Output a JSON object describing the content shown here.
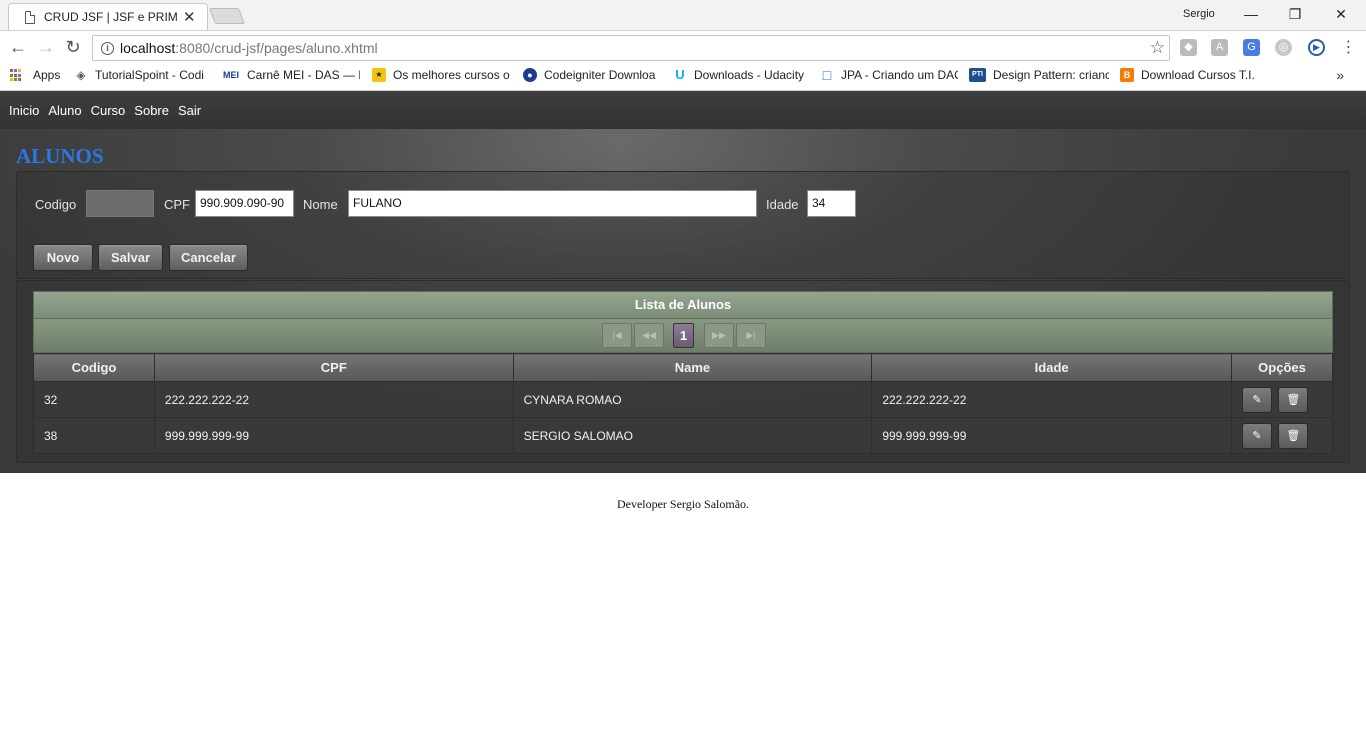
{
  "browser": {
    "tab_title": "CRUD JSF | JSF e PRIMEFACES",
    "tab_close": "✕",
    "profile": "Sergio",
    "window": {
      "minimize": "—",
      "restore": "❐",
      "close": "✕"
    },
    "nav": {
      "back": "←",
      "forward": "→",
      "reload": "↻"
    },
    "url_host": "localhost",
    "url_rest": ":8080/crud-jsf/pages/aluno.xhtml",
    "bookmarks": {
      "apps": "Apps",
      "items": [
        {
          "label": "TutorialSpoint - Codi",
          "icon": "◈"
        },
        {
          "label": "Carnê MEI - DAS — P",
          "icon": "MEI"
        },
        {
          "label": "Os melhores cursos o",
          "icon": "★"
        },
        {
          "label": "Codeigniter Downloa",
          "icon": "●"
        },
        {
          "label": "Downloads - Udacity",
          "icon": "U"
        },
        {
          "label": "JPA - Criando um DAO",
          "icon": "□"
        },
        {
          "label": "Design Pattern: crianc",
          "icon": "PTI"
        },
        {
          "label": "Download Cursos T.I.",
          "icon": "B"
        }
      ],
      "more": "»"
    }
  },
  "menu": [
    "Inicio",
    "Aluno",
    "Curso",
    "Sobre",
    "Sair"
  ],
  "page_title": "ALUNOS",
  "form": {
    "codigo_label": "Codigo",
    "codigo_value": "",
    "cpf_label": "CPF",
    "cpf_value": "990.909.090-90",
    "nome_label": "Nome",
    "nome_value": "FULANO",
    "idade_label": "Idade",
    "idade_value": "34",
    "buttons": {
      "novo": "Novo",
      "salvar": "Salvar",
      "cancelar": "Cancelar"
    }
  },
  "grid": {
    "caption": "Lista de Alunos",
    "paginator": {
      "first": "|◀",
      "prev": "◀◀",
      "current_page": "1",
      "next": "▶▶",
      "last": "▶|"
    },
    "columns": [
      "Codigo",
      "CPF",
      "Name",
      "Idade",
      "Opções"
    ],
    "rows": [
      {
        "codigo": "32",
        "cpf": "222.222.222-22",
        "name": "CYNARA ROMAO",
        "idade": "222.222.222-22"
      },
      {
        "codigo": "38",
        "cpf": "999.999.999-99",
        "name": "SERGIO SALOMAO",
        "idade": "999.999.999-99"
      }
    ],
    "edit_icon": "✎",
    "delete_icon": "🗑"
  },
  "footer": "Developer Sergio Salomão.",
  "colors": {
    "title": "#2a78e4",
    "caption": "#8a9b86",
    "page_active": "#7b6a82"
  }
}
